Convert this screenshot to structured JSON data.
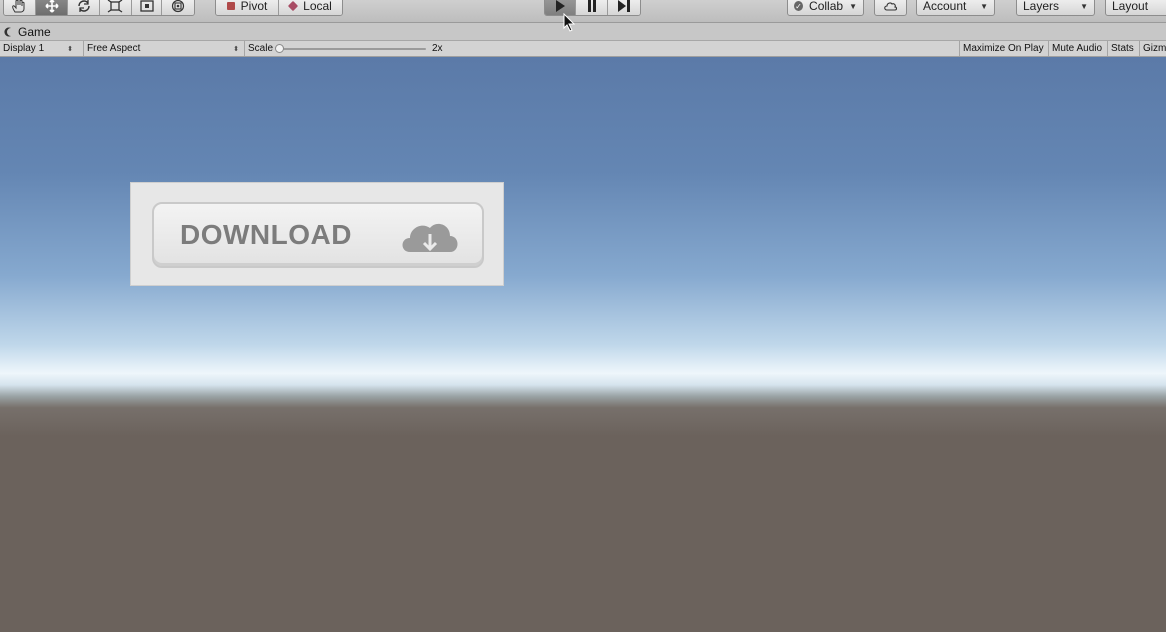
{
  "toolbar": {
    "pivot_label": "Pivot",
    "local_label": "Local",
    "collab_label": "Collab",
    "account_label": "Account",
    "layers_label": "Layers",
    "layout_label": "Layout",
    "tools": [
      "hand-tool-icon",
      "move-tool-icon",
      "rotate-tool-icon",
      "scale-tool-icon",
      "rect-tool-icon",
      "transform-tool-icon"
    ],
    "play_controls": [
      "play-icon",
      "pause-icon",
      "step-icon"
    ]
  },
  "tab": {
    "title": "Game"
  },
  "gamebar": {
    "display": "Display 1",
    "aspect": "Free Aspect",
    "scale_label": "Scale",
    "scale_value": "2x",
    "maximize_on_play": "Maximize On Play",
    "mute_audio": "Mute Audio",
    "stats": "Stats",
    "gizmos": "Gizm"
  },
  "scene": {
    "download_button_label": "DOWNLOAD"
  },
  "colors": {
    "sky_top": "#5b7aa8",
    "ground": "#6b625c",
    "toolbar_bg": "#c4c4c4"
  }
}
